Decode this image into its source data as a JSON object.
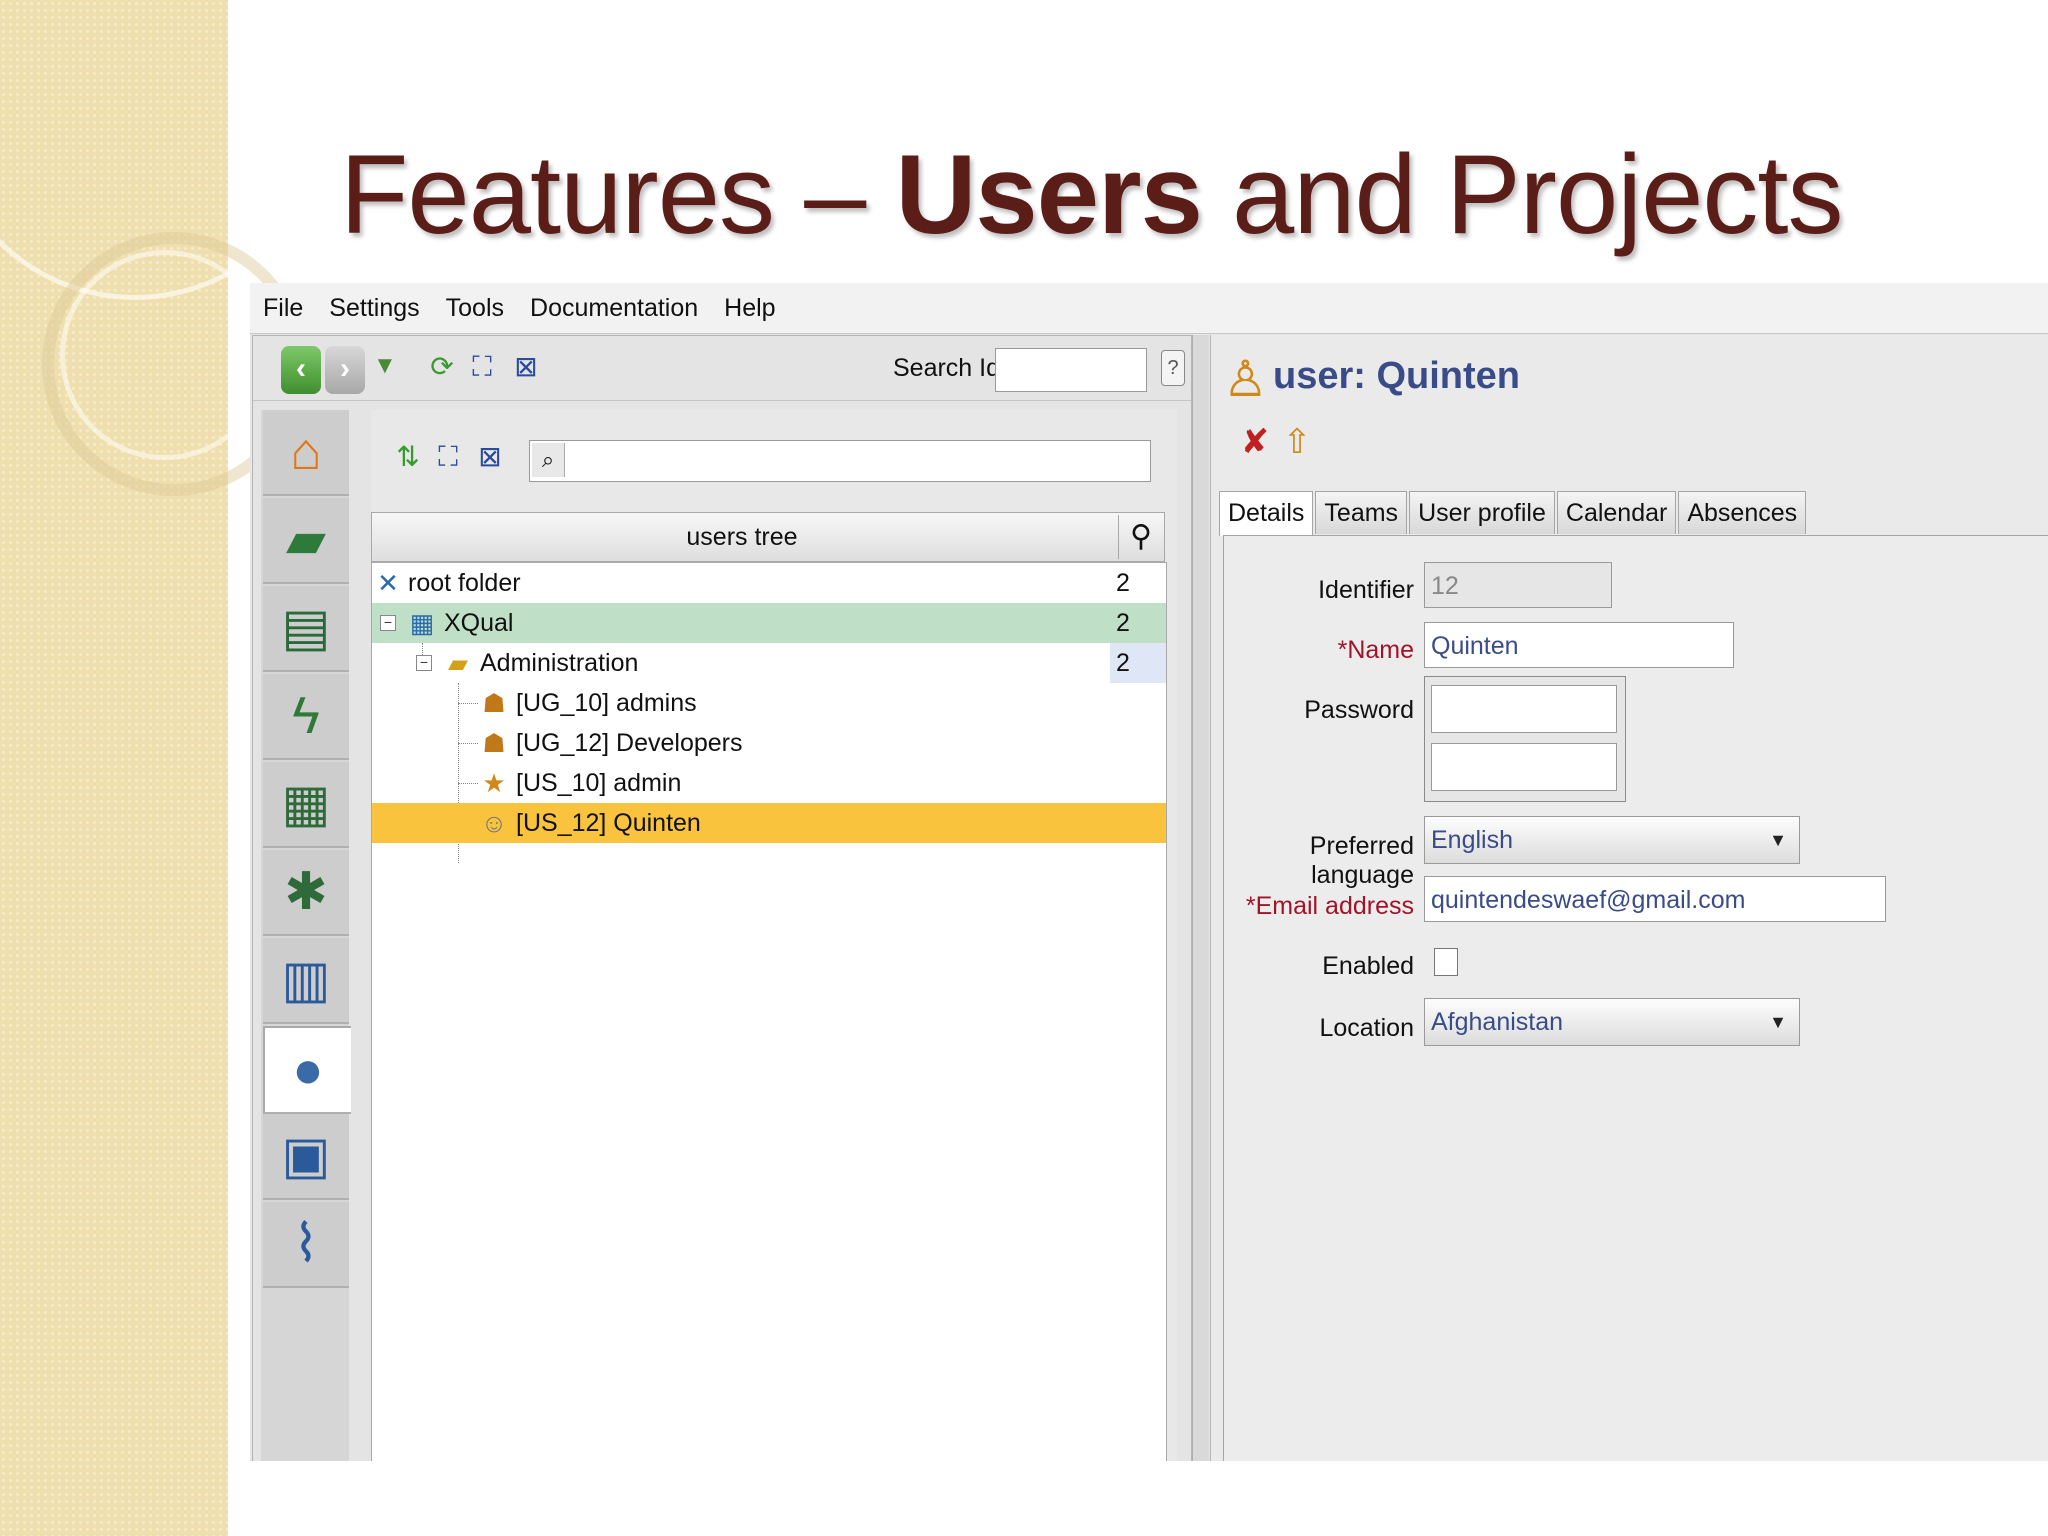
{
  "slide": {
    "title_prefix": "Features – ",
    "title_bold": "Users",
    "title_suffix": " and Projects",
    "title_color": "#5a1d18"
  },
  "menu": [
    "File",
    "Settings",
    "Tools",
    "Documentation",
    "Help"
  ],
  "toolbar": {
    "search_id_label": "Search Id:",
    "search_id_value": "",
    "help_icon": "?"
  },
  "sidebar": [
    "home-icon",
    "ruler-icon",
    "blackboard-icon",
    "lightning-icon",
    "clapperboard-icon",
    "bug-icon",
    "diagram-icon",
    "user-icon",
    "computer-icon",
    "paperclip-icon"
  ],
  "tree": {
    "header": "users tree",
    "filter_value": "",
    "rows": [
      {
        "label": "root folder",
        "count": "2"
      },
      {
        "label": "XQual",
        "count": "2"
      },
      {
        "label": "Administration",
        "count": "2"
      },
      {
        "label": "[UG_10] admins",
        "count": ""
      },
      {
        "label": "[UG_12] Developers",
        "count": ""
      },
      {
        "label": "[US_10] admin",
        "count": ""
      },
      {
        "label": "[US_12] Quinten",
        "count": ""
      }
    ]
  },
  "details": {
    "title": "user: Quinten",
    "tabs": [
      "Details",
      "Teams",
      "User profile",
      "Calendar",
      "Absences"
    ],
    "active_tab": "Details",
    "fields": {
      "identifier_label": "Identifier",
      "identifier_value": "12",
      "name_star": "*",
      "name_label": "Name",
      "name_value": "Quinten",
      "password_label": "Password",
      "language_label": "Preferred language",
      "language_value": "English",
      "email_star": "*",
      "email_label": "Email address",
      "email_value": "quintendeswaef@gmail.com",
      "enabled_label": "Enabled",
      "enabled": false,
      "location_label": "Location",
      "location_value": "Afghanistan"
    }
  },
  "colors": {
    "selected_group": "#bfe0c6",
    "selected_user": "#f9c33e",
    "required_label": "#a0142a",
    "value_text": "#3a4c88"
  }
}
